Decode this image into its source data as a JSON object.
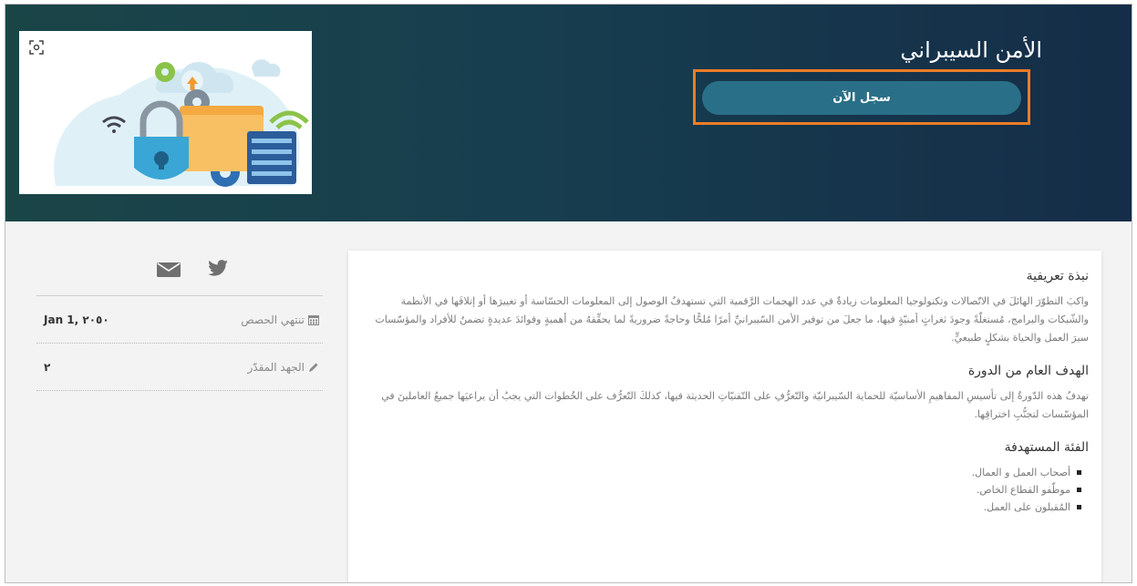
{
  "hero": {
    "title": "الأمن السيبراني",
    "register_label": "سجل الآن"
  },
  "sidebar": {
    "rows": [
      {
        "label": "تنتهي الحصص",
        "value": "Jan 1, ٢٠٥٠",
        "icon": "calendar-icon"
      },
      {
        "label": "الجهد المقدّر",
        "value": "٢",
        "icon": "pencil-icon"
      }
    ],
    "social_icons": [
      "twitter-icon",
      "envelope-icon"
    ]
  },
  "card": {
    "sections": [
      {
        "heading": "نبذة تعريفية",
        "text": "واكبَ التطوّرَ الهائلَ في الاتّصالات وتكنولوجيا المعلومات زيادةٌ في عدد الهجمات الرَّقمية التي تستهدفُ الوصول إلى المعلومات الحسّاسة أو تغييرَها أو إتلافَها في الأنظمة والشّبكات والبرامج، مُستغلّةً وجودَ ثغراتٍ أمنيّةٍ فيها، ما جعلَ من توفير الأمن السّيبرانيِّ أمرًا مُلحًّا وحاجةً ضروريةً لما يحقِّقهُ من أهميةٍ وفوائدَ عديدةٍ تضمنُ للأفراد والمؤسّسات سيرَ العمل والحياة بشكلٍ طبيعيٍّ."
      },
      {
        "heading": "الهدف العام من الدورة",
        "text": "تهدفُ هذه الدّورةُ إلى تأسيسِ المفاهيمِ الأساسيّة للحماية السّيبرانيّة والتّعرُّفِ على التّقنيّاتِ الحديثة فيها، كذلكَ التّعرُّف على الخُطوات التي يجبُ أن يراعيَها جميعُ العاملينَ في المؤسّسات لتجنُّبِ اختراقِها."
      },
      {
        "heading": "الفئة المستهدفة",
        "items": [
          "أصحاب العمل و العمال.",
          "موظّفو القطاع الخاص.",
          "المُقبلون على العمل."
        ]
      }
    ]
  },
  "colors": {
    "hero_start": "#1a4547",
    "hero_end": "#152d48",
    "button": "#2a6f88",
    "highlight": "#ec7d26"
  }
}
